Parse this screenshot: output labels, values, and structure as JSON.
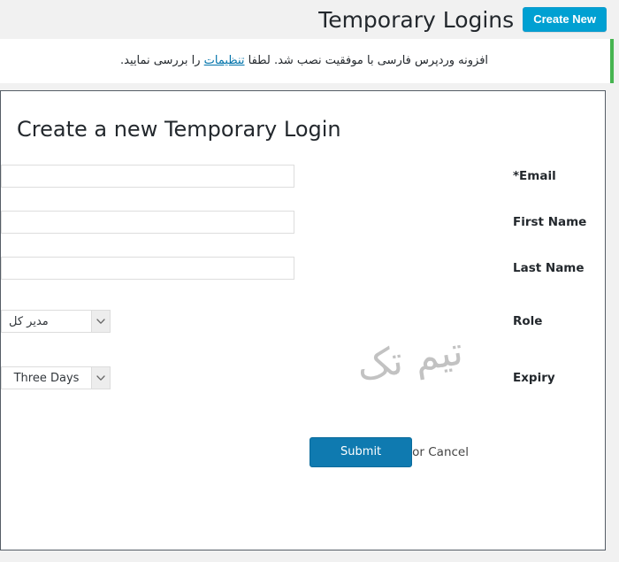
{
  "header": {
    "title": "Temporary Logins",
    "create_new_label": "Create New"
  },
  "notice": {
    "text_before_link": "افزونه وردپرس فارسی با موفقیت نصب شد. لطفا ",
    "link_label": "تنظیمات",
    "text_after_link": " را بررسی نمایید.",
    "accent_color": "#46b450"
  },
  "form": {
    "heading": "Create a new Temporary Login",
    "fields": [
      {
        "label": "*Email",
        "value": "",
        "placeholder": "",
        "type": "text"
      },
      {
        "label": "First Name",
        "value": "",
        "placeholder": "",
        "type": "text"
      },
      {
        "label": "Last Name",
        "value": "",
        "placeholder": "",
        "type": "text"
      }
    ],
    "role": {
      "label": "Role",
      "selected": "مدیر کل"
    },
    "expiry": {
      "label": "Expiry",
      "selected": "Three Days"
    },
    "submit_label": "Submit",
    "cancel_label": "or Cancel"
  },
  "watermark": {
    "text": "تیم تک"
  },
  "colors": {
    "accent_blue": "#00a0d2",
    "submit_blue": "#0f7ab0",
    "notice_green": "#46b450",
    "page_bg": "#f1f1f1"
  }
}
